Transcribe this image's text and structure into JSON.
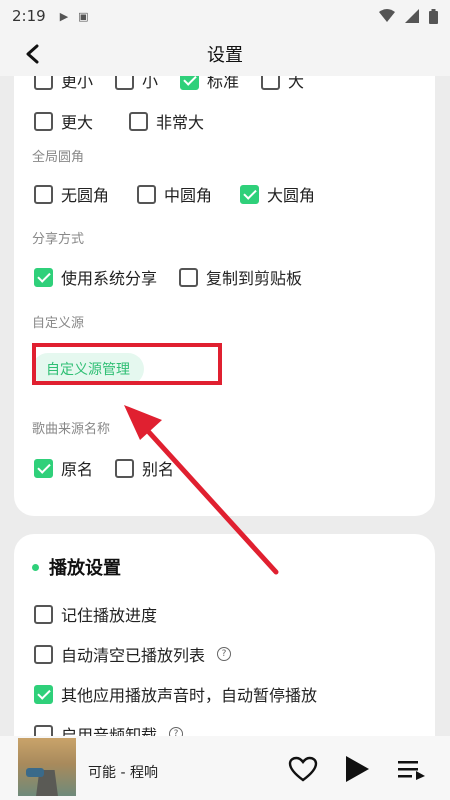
{
  "status_bar": {
    "time": "2:19"
  },
  "app_bar": {
    "title": "设置"
  },
  "card1": {
    "partial_row": [
      {
        "label": "更小",
        "checked": false
      },
      {
        "label": "小",
        "checked": false
      },
      {
        "label": "标准",
        "checked": true
      },
      {
        "label": "大",
        "checked": false
      }
    ],
    "font_size_row2": [
      {
        "label": "更大",
        "checked": false
      },
      {
        "label": "非常大",
        "checked": false
      }
    ],
    "corner": {
      "label": "全局圆角",
      "options": [
        {
          "label": "无圆角",
          "checked": false
        },
        {
          "label": "中圆角",
          "checked": false
        },
        {
          "label": "大圆角",
          "checked": true
        }
      ]
    },
    "share": {
      "label": "分享方式",
      "options": [
        {
          "label": "使用系统分享",
          "checked": true
        },
        {
          "label": "复制到剪贴板",
          "checked": false
        }
      ]
    },
    "custom_source": {
      "label": "自定义源",
      "button": "自定义源管理"
    },
    "song_source_name": {
      "label": "歌曲来源名称",
      "options": [
        {
          "label": "原名",
          "checked": true
        },
        {
          "label": "别名",
          "checked": false
        }
      ]
    }
  },
  "card2": {
    "title": "播放设置",
    "items": [
      {
        "label": "记住播放进度",
        "checked": false
      },
      {
        "label": "自动清空已播放列表",
        "checked": false,
        "help": "?"
      },
      {
        "label": "其他应用播放声音时，自动暂停播放",
        "checked": true
      },
      {
        "label": "启用音频卸载",
        "checked": false,
        "help": "?"
      }
    ]
  },
  "player": {
    "song": "可能 - 程响"
  },
  "colors": {
    "accent": "#2fd07a",
    "highlight": "#e02030"
  }
}
